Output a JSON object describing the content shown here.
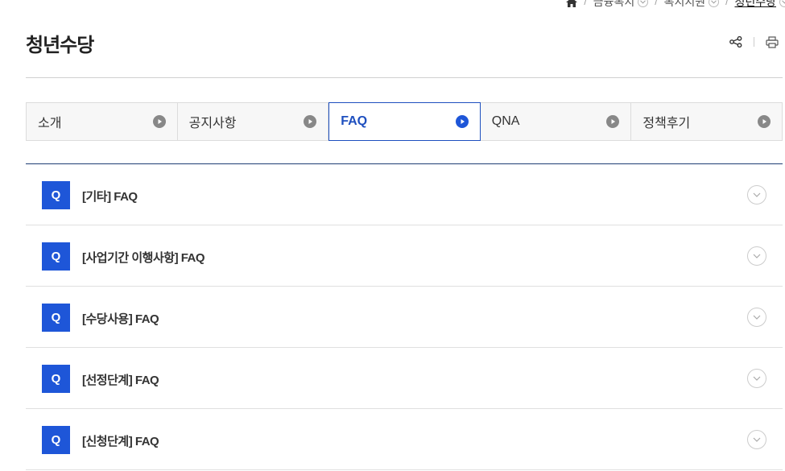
{
  "breadcrumb": {
    "items": [
      {
        "label": "금융복지"
      },
      {
        "label": "복지지원"
      },
      {
        "label": "청년수당"
      }
    ]
  },
  "page": {
    "title": "청년수당"
  },
  "tabs": [
    {
      "label": "소개",
      "active": false
    },
    {
      "label": "공지사항",
      "active": false
    },
    {
      "label": "FAQ",
      "active": true
    },
    {
      "label": "QNA",
      "active": false
    },
    {
      "label": "정책후기",
      "active": false
    }
  ],
  "faq": {
    "badge": "Q",
    "items": [
      {
        "title": "[기타] FAQ"
      },
      {
        "title": "[사업기간 이행사항] FAQ"
      },
      {
        "title": "[수당사용] FAQ"
      },
      {
        "title": "[선정단계] FAQ"
      },
      {
        "title": "[신청단계] FAQ"
      }
    ]
  },
  "colors": {
    "accent": "#1e56d8",
    "active_tab": "#1e4fbf",
    "list_top_border": "#1f3d73"
  }
}
